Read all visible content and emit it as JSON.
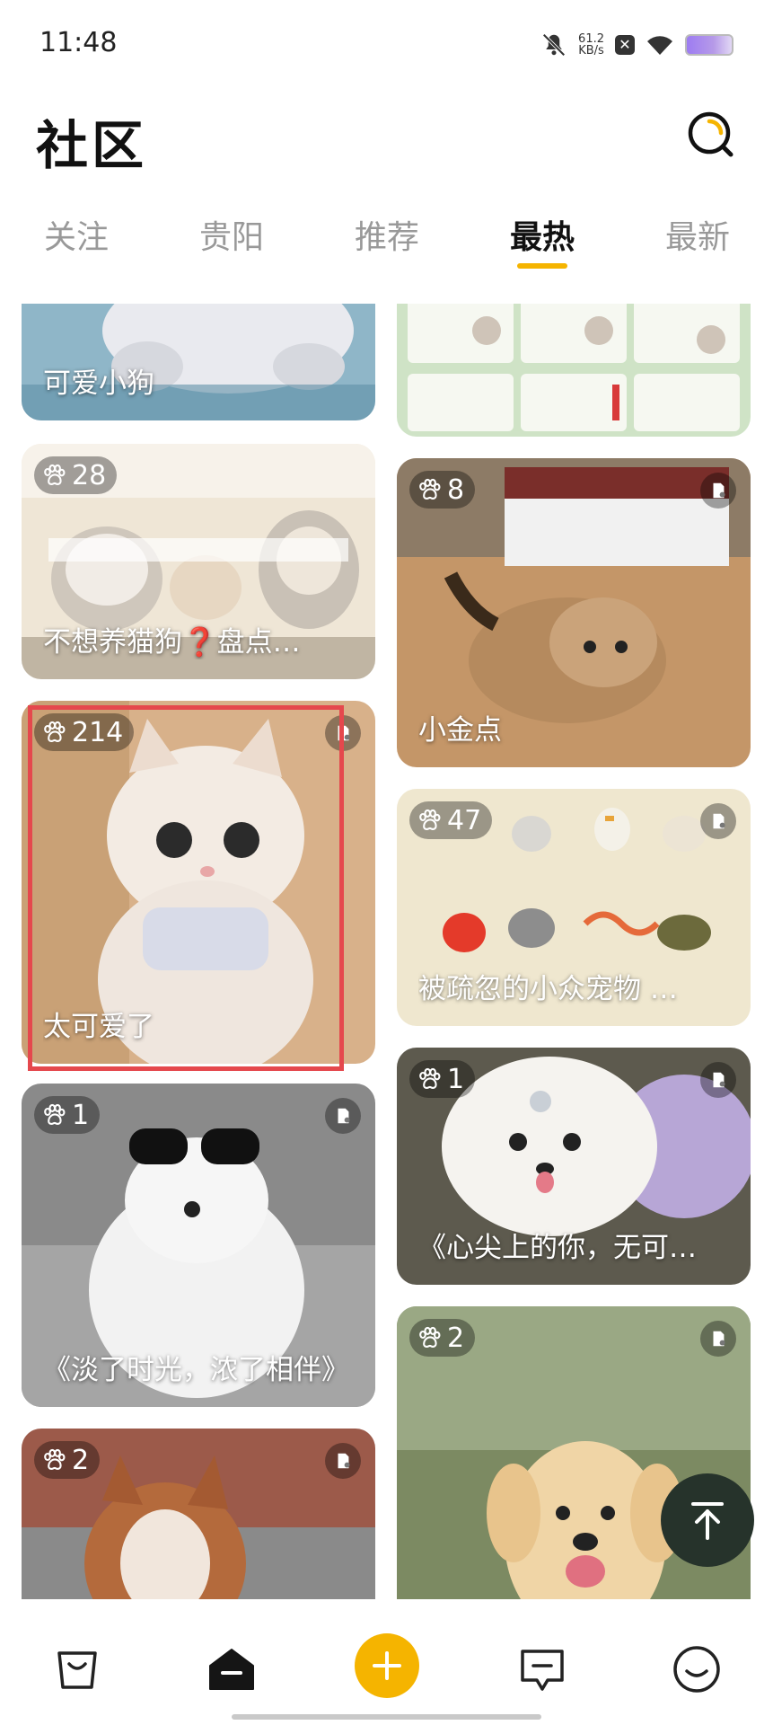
{
  "status_bar": {
    "time": "11:48",
    "net_speed_value": "61.2",
    "net_speed_unit": "KB/s",
    "icons": [
      "bell-mute-icon",
      "x-badge-icon",
      "wifi-icon",
      "battery-icon"
    ]
  },
  "header": {
    "title": "社区",
    "search_icon": "search-icon"
  },
  "tabs": [
    {
      "label": "关注",
      "active": false
    },
    {
      "label": "贵阳",
      "active": false
    },
    {
      "label": "推荐",
      "active": false
    },
    {
      "label": "最热",
      "active": true
    },
    {
      "label": "最新",
      "active": false
    }
  ],
  "colors": {
    "accent": "#f5b400",
    "highlight_border": "#e5484d",
    "text_primary": "#111111",
    "text_muted": "#999999"
  },
  "feed": {
    "left_column": [
      {
        "title": "可爱小狗",
        "count": ""
      },
      {
        "title": "不想养猫狗❓盘点…",
        "count": "28"
      },
      {
        "title": "太可爱了",
        "count": "214",
        "highlighted": true
      },
      {
        "title": "《淡了时光，浓了相伴》",
        "count": "1"
      },
      {
        "title": "",
        "count": "2"
      }
    ],
    "right_column": [
      {
        "title": "",
        "count": ""
      },
      {
        "title": "小金点",
        "count": "8"
      },
      {
        "title": "被疏忽的小众宠物 …",
        "count": "47"
      },
      {
        "title": "《心尖上的你，无可…",
        "count": "1"
      },
      {
        "title": "",
        "count": "2"
      }
    ]
  },
  "scroll_top_icon": "arrow-up-to-top-icon",
  "bottom_nav": {
    "items": [
      "shopping-bag-icon",
      "home-icon",
      "add-icon",
      "message-icon",
      "profile-icon"
    ],
    "active": "home-icon"
  }
}
